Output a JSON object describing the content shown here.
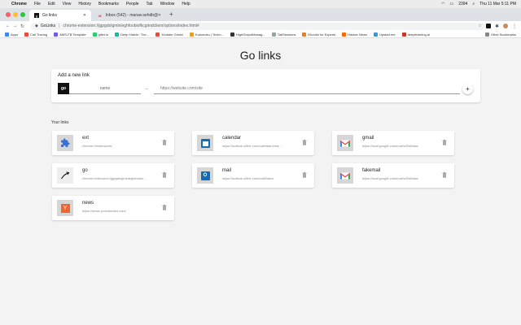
{
  "menubar": {
    "app": "Chrome",
    "items": [
      "File",
      "Edit",
      "View",
      "History",
      "Bookmarks",
      "People",
      "Tab",
      "Window",
      "Help"
    ],
    "status_number": "2394",
    "clock": "Thu 11 Mar  5:11 PM"
  },
  "tabs": [
    {
      "title": "Go links",
      "active": true
    },
    {
      "title": "Inbox (542) - manav.sehdb@...",
      "active": false
    }
  ],
  "toolbar": {
    "site_label": "GoLinks",
    "url": "chrome-extension://jgpgdolgmlnleghfoobiofkcgimdcliem/options/index.html#"
  },
  "bookmarks": [
    {
      "label": "Apps",
      "color": "#4285f4"
    },
    {
      "label": "Call Tracing",
      "color": "#e74c3c"
    },
    {
      "label": "AMS-FB Template",
      "color": "#6c5ce7"
    },
    {
      "label": "gillet.io",
      "color": "#2ecc71"
    },
    {
      "label": "Deep Hatchr: The...",
      "color": "#1abc9c"
    },
    {
      "label": "Youtube Gimini",
      "color": "#e74c3c"
    },
    {
      "label": "Kukunoku | Techn...",
      "color": "#f39c12"
    },
    {
      "label": "HighOutputManag...",
      "color": "#333333"
    },
    {
      "label": "TabSessions",
      "color": "#95a5a6"
    },
    {
      "label": "Ebooks for Experts",
      "color": "#e67e22"
    },
    {
      "label": "Hacker News",
      "color": "#ff6600"
    },
    {
      "label": "Upstart.me",
      "color": "#3498db"
    },
    {
      "label": "deeplearning.ai",
      "color": "#c0392b"
    }
  ],
  "bookmarks_other": "Other Bookmarks",
  "page": {
    "title": "Go links",
    "add": {
      "label": "Add a new link",
      "prefix": "go",
      "name_placeholder": "name",
      "arrow": "→",
      "url_placeholder": "https://website.com/site",
      "plus": "+"
    },
    "your_links": "Your links",
    "links": [
      {
        "name": "ext",
        "url": "chrome://extensions/",
        "icon": "puzzle-icon"
      },
      {
        "name": "calendar",
        "url": "https://outlook.office.com/calendar/view...",
        "icon": "outlook-calendar-icon"
      },
      {
        "name": "gmail",
        "url": "https://mail.google.com/mail/u/0/#inbox",
        "icon": "gmail-icon"
      },
      {
        "name": "go",
        "url": "chrome-extension://jgpgdolgmlnleghfoobio...",
        "icon": "golinks-arrow-icon"
      },
      {
        "name": "mail",
        "url": "https://outlook.office.com/mail/inbox",
        "icon": "outlook-mail-icon"
      },
      {
        "name": "fakemail",
        "url": "https://mail.google.com/mail/u/0/#inbox",
        "icon": "gmail-icon"
      },
      {
        "name": "news",
        "url": "https://news.ycombinator.com/",
        "icon": "hacker-news-icon"
      }
    ]
  }
}
